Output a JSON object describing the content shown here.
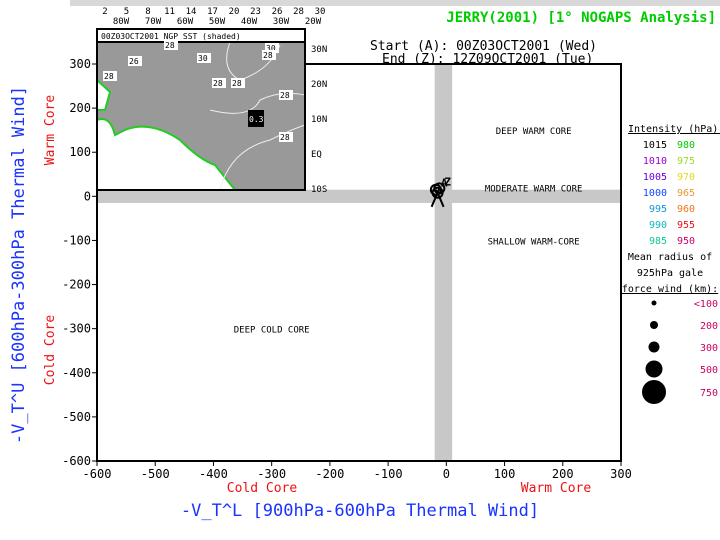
{
  "title": "JERRY(2001) [1° NOGAPS Analysis]",
  "start_label": "Start (A): 00Z03OCT2001 (Wed)",
  "end_label": "End (Z): 12Z09OCT2001 (Tue)",
  "colors": {
    "title": "#00cc00",
    "axis_title": "#1a33ff",
    "core_label": "#ee1111",
    "band": "#c8c8c8"
  },
  "chart_data": {
    "type": "scatter",
    "xlabel": "-V_T^L [900hPa-600hPa Thermal Wind]",
    "ylabel": "-V_T^U [600hPa-300hPa Thermal Wind]",
    "xlim": [
      -600,
      300
    ],
    "ylim": [
      -600,
      300
    ],
    "xticks": [
      -600,
      -500,
      -400,
      -300,
      -200,
      -100,
      0,
      100,
      200,
      300
    ],
    "yticks": [
      300,
      200,
      100,
      0,
      -100,
      -200,
      -300,
      -400,
      -500,
      -600
    ],
    "x_side_labels": {
      "left": "Cold Core",
      "right": "Warm Core"
    },
    "y_side_labels": {
      "top": "Warm Core",
      "bottom": "Cold Core"
    },
    "regions": [
      {
        "text": "DEEP WARM CORE",
        "x": 150,
        "y": 150
      },
      {
        "text": "MODERATE WARM CORE",
        "x": 150,
        "y": 20
      },
      {
        "text": "SHALLOW WARM-CORE",
        "x": 150,
        "y": -100
      },
      {
        "text": "DEEP COLD CORE",
        "x": -300,
        "y": -300
      }
    ],
    "track": [
      {
        "label": "A",
        "x": -18,
        "y": 15
      },
      {
        "x": -15,
        "y": 8
      },
      {
        "label": "Z",
        "x": -12,
        "y": 18
      }
    ],
    "intensity_legend": {
      "title": "Intensity (hPa):",
      "items": [
        {
          "v": "1015",
          "c": "#000000"
        },
        {
          "v": "980",
          "c": "#00cc00"
        },
        {
          "v": "1010",
          "c": "#9900cc"
        },
        {
          "v": "975",
          "c": "#99dd22"
        },
        {
          "v": "1005",
          "c": "#6600dd"
        },
        {
          "v": "970",
          "c": "#e8d820"
        },
        {
          "v": "1000",
          "c": "#1144ff"
        },
        {
          "v": "965",
          "c": "#e89a30"
        },
        {
          "v": "995",
          "c": "#1199dd"
        },
        {
          "v": "960",
          "c": "#ee7711"
        },
        {
          "v": "990",
          "c": "#11bbbb"
        },
        {
          "v": "955",
          "c": "#ee1111"
        },
        {
          "v": "985",
          "c": "#11cc88"
        },
        {
          "v": "950",
          "c": "#cc0066"
        }
      ]
    },
    "radius_legend": {
      "title_lines": [
        "Mean radius of",
        "925hPa gale",
        "force wind (km):"
      ],
      "items": [
        "<100",
        "200",
        "300",
        "500",
        "750"
      ]
    }
  },
  "inset": {
    "title": "00Z03OCT2001 NGP SST (shaded)",
    "colorbar_ticks": [
      "2",
      "5",
      "8",
      "11",
      "14",
      "17",
      "20",
      "23",
      "26",
      "28",
      "30"
    ],
    "lon_labels": [
      "80W",
      "70W",
      "60W",
      "50W",
      "40W",
      "30W",
      "20W"
    ],
    "lat_labels": [
      "30N",
      "20N",
      "10N",
      "EQ",
      "10S"
    ],
    "contour_labels": [
      "28",
      "26",
      "28",
      "30",
      "28",
      "30",
      "28",
      "28",
      "28",
      "28"
    ],
    "storm_label": "0.3"
  }
}
